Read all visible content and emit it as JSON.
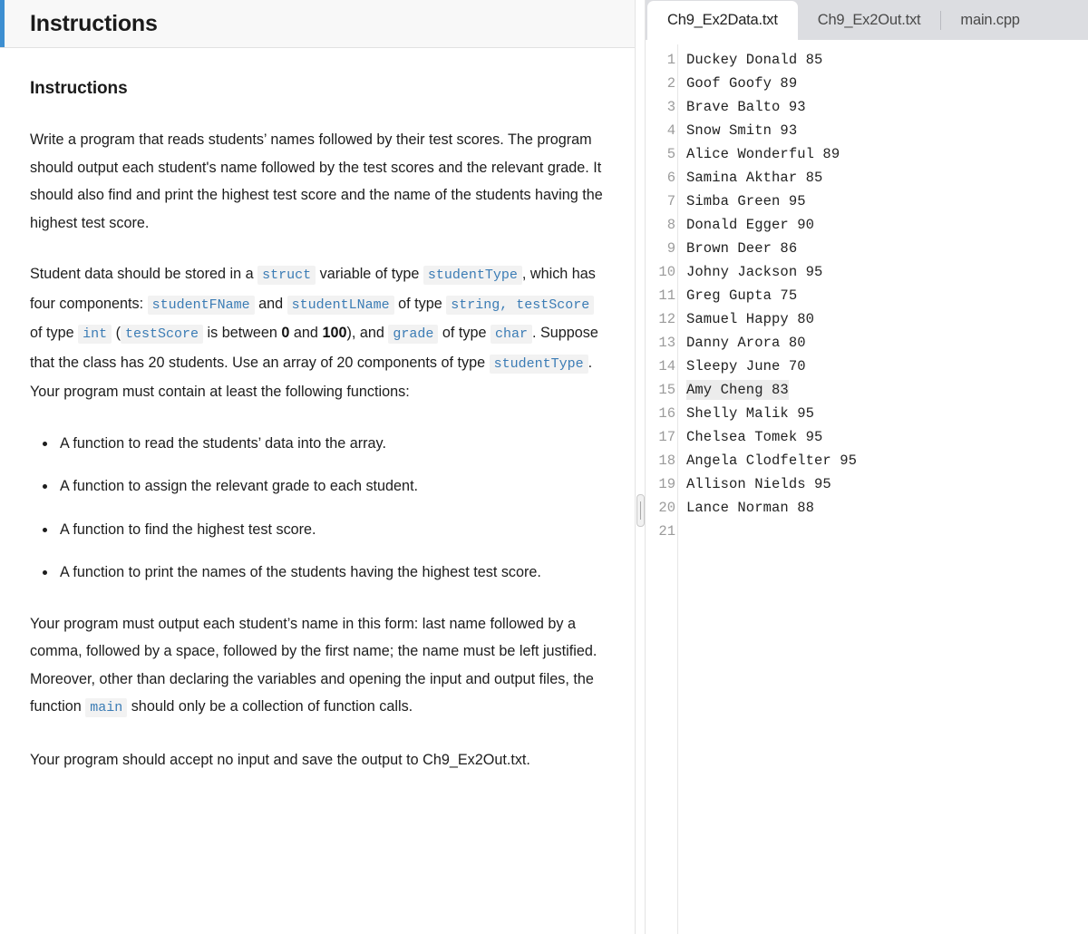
{
  "instructions_panel": {
    "header_title": "Instructions",
    "accent_color": "#3d8fd1",
    "section_title": "Instructions",
    "paragraph_1": "Write a program that reads students’ names followed by their test scores. The program should output each student's name followed by the test scores and the relevant grade. It should also find and print the highest test score and the name of the students having the highest test score.",
    "paragraph_2": {
      "t1": "Student data should be stored in a ",
      "c1": "struct",
      "t2": " variable of type ",
      "c2": "studentType",
      "t3": ", which has four components: ",
      "c3": "studentFName",
      "t4": " and ",
      "c4": "studentLName",
      "t5": " of type ",
      "c5": "string, testScore",
      "t6": " of type ",
      "c6": "int",
      "t7": " (",
      "c7": "testScore",
      "t8": " is between ",
      "b1": "0",
      "t9": " and ",
      "b2": "100",
      "t10": "), and ",
      "c8": "grade",
      "t11": " of type ",
      "c9": "char",
      "t12": ". Suppose that the class has 20 students. Use an array of 20 components of type ",
      "c10": "studentType",
      "t13": ". Your program must contain at least the following functions:"
    },
    "function_list": [
      "A function to read the students’ data into the array.",
      "A function to assign the relevant grade to each student.",
      "A function to find the highest test score.",
      "A function to print the names of the students having the highest test score."
    ],
    "paragraph_3": {
      "t1": "Your program must output each student’s name in this form: last name followed by a comma, followed by a space, followed by the first name; the name must be left justified. Moreover, other than declaring the variables and opening the input and output files, the function ",
      "c1": "main",
      "t2": " should only be a collection of function calls."
    },
    "paragraph_4": "Your program should accept no input and save the output to Ch9_Ex2Out.txt."
  },
  "editor_panel": {
    "tabs": [
      {
        "label": "Ch9_Ex2Data.txt",
        "active": true,
        "separator": false
      },
      {
        "label": "Ch9_Ex2Out.txt",
        "active": false,
        "separator": false
      },
      {
        "label": "main.cpp",
        "active": false,
        "separator": true
      }
    ],
    "line_numbers": [
      "1",
      "2",
      "3",
      "4",
      "5",
      "6",
      "7",
      "8",
      "9",
      "10",
      "11",
      "12",
      "13",
      "14",
      "15",
      "16",
      "17",
      "18",
      "19",
      "20",
      "21"
    ],
    "lines": [
      {
        "n": 1,
        "text": "Duckey Donald 85",
        "highlighted": false
      },
      {
        "n": 2,
        "text": "Goof Goofy 89",
        "highlighted": false
      },
      {
        "n": 3,
        "text": "Brave Balto 93",
        "highlighted": false
      },
      {
        "n": 4,
        "text": "Snow Smitn 93",
        "highlighted": false
      },
      {
        "n": 5,
        "text": "Alice Wonderful 89",
        "highlighted": false
      },
      {
        "n": 6,
        "text": "Samina Akthar 85",
        "highlighted": false
      },
      {
        "n": 7,
        "text": "Simba Green 95",
        "highlighted": false
      },
      {
        "n": 8,
        "text": "Donald Egger 90",
        "highlighted": false
      },
      {
        "n": 9,
        "text": "Brown Deer 86",
        "highlighted": false
      },
      {
        "n": 10,
        "text": "Johny Jackson 95",
        "highlighted": false
      },
      {
        "n": 11,
        "text": "Greg Gupta 75",
        "highlighted": false
      },
      {
        "n": 12,
        "text": "Samuel Happy 80",
        "highlighted": false
      },
      {
        "n": 13,
        "text": "Danny Arora 80",
        "highlighted": false
      },
      {
        "n": 14,
        "text": "Sleepy June 70",
        "highlighted": false
      },
      {
        "n": 15,
        "text": "Amy Cheng 83",
        "highlighted": true
      },
      {
        "n": 16,
        "text": "Shelly Malik 95",
        "highlighted": false
      },
      {
        "n": 17,
        "text": "Chelsea Tomek 95",
        "highlighted": false
      },
      {
        "n": 18,
        "text": "Angela Clodfelter 95",
        "highlighted": false
      },
      {
        "n": 19,
        "text": "Allison Nields 95",
        "highlighted": false
      },
      {
        "n": 20,
        "text": "Lance Norman 88",
        "highlighted": false
      },
      {
        "n": 21,
        "text": "",
        "highlighted": false
      }
    ]
  }
}
